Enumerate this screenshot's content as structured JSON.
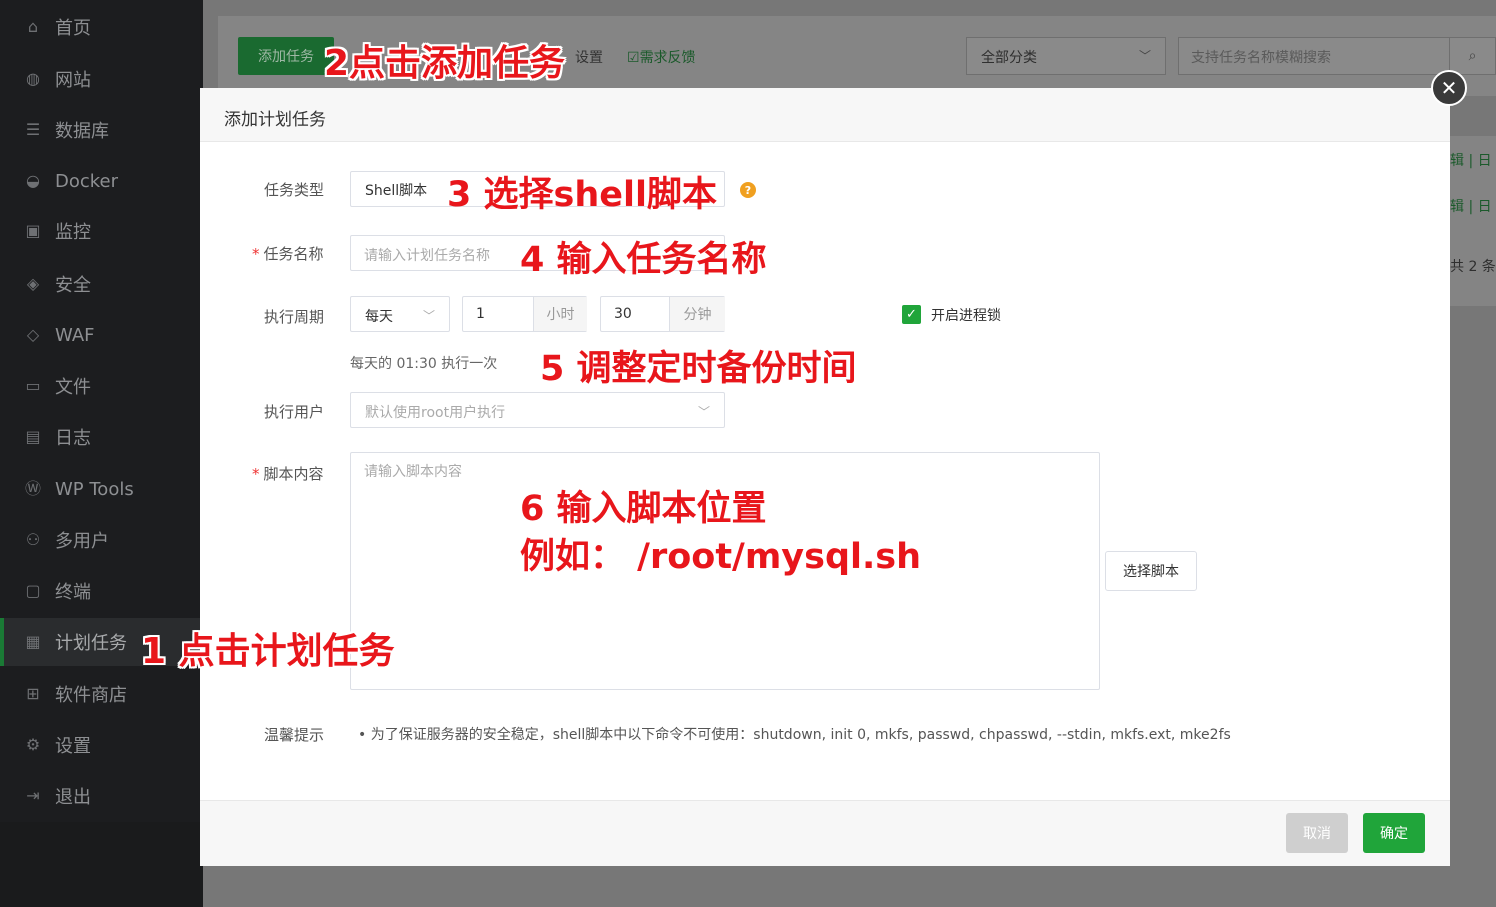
{
  "sidebar": {
    "items": [
      {
        "label": "首页",
        "icon": "home-icon"
      },
      {
        "label": "网站",
        "icon": "globe-icon"
      },
      {
        "label": "数据库",
        "icon": "database-icon"
      },
      {
        "label": "Docker",
        "icon": "docker-icon"
      },
      {
        "label": "监控",
        "icon": "monitor-icon"
      },
      {
        "label": "安全",
        "icon": "shield-icon"
      },
      {
        "label": "WAF",
        "icon": "waf-shield-icon"
      },
      {
        "label": "文件",
        "icon": "folder-icon"
      },
      {
        "label": "日志",
        "icon": "log-icon"
      },
      {
        "label": "WP Tools",
        "icon": "wordpress-icon"
      },
      {
        "label": "多用户",
        "icon": "users-icon"
      },
      {
        "label": "终端",
        "icon": "terminal-icon"
      },
      {
        "label": "计划任务",
        "icon": "calendar-icon",
        "active": true
      },
      {
        "label": "软件商店",
        "icon": "apps-icon"
      },
      {
        "label": "设置",
        "icon": "gear-icon"
      },
      {
        "label": "退出",
        "icon": "logout-icon"
      }
    ]
  },
  "background": {
    "add_task": "添加任务",
    "settings_link": "设置",
    "feedback": "需求反馈",
    "category_select": "全部分类",
    "search_placeholder": "支持任务名称模糊搜索",
    "row_edit": "辑",
    "row_extra": "日",
    "total": "共 2 条"
  },
  "modal": {
    "title": "添加计划任务",
    "task_type_label": "任务类型",
    "task_type_value": "Shell脚本",
    "task_name_label": "任务名称",
    "task_name_placeholder": "请输入计划任务名称",
    "cycle_label": "执行周期",
    "cycle_value": "每天",
    "hour_value": "1",
    "hour_suffix": "小时",
    "minute_value": "30",
    "minute_suffix": "分钟",
    "process_lock": "开启进程锁",
    "cycle_hint": "每天的 01:30 执行一次",
    "user_label": "执行用户",
    "user_placeholder": "默认使用root用户执行",
    "script_label": "脚本内容",
    "script_placeholder": "请输入脚本内容",
    "choose_script": "选择脚本",
    "tips_label": "温馨提示",
    "tips_text": "为了保证服务器的安全稳定，shell脚本中以下命令不可使用：shutdown, init 0, mkfs, passwd, chpasswd, --stdin, mkfs.ext, mke2fs",
    "cancel": "取消",
    "confirm": "确定"
  },
  "annotations": {
    "a1": "1 点击计划任务",
    "a2": "2点击添加任务",
    "a3": "3 选择shell脚本",
    "a4": "4 输入任务名称",
    "a5": "5 调整定时备份时间",
    "a6_line1": "6 输入脚本位置",
    "a6_line2": "例如：  /root/mysql.sh"
  },
  "colors": {
    "accent_green": "#20a53a",
    "annotation_red": "#e8161b",
    "sidebar_bg": "#1c1d1f"
  }
}
